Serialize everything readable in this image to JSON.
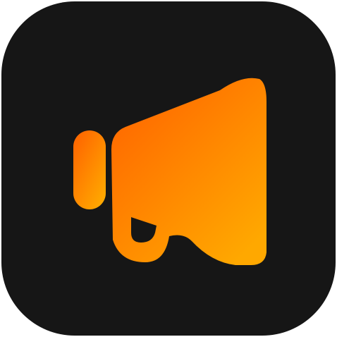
{
  "app_icon": {
    "icon": "megaphone-icon",
    "background_color": "#161616",
    "gradient": {
      "start_color": "#ff6a00",
      "end_color": "#ffa800"
    }
  }
}
